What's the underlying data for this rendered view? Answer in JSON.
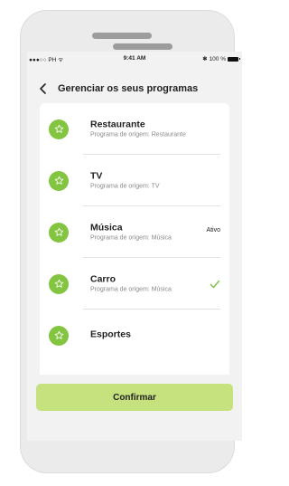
{
  "statusbar": {
    "carrier": "●●●○○ PH ᯤ",
    "time": "9:41 AM",
    "bluetooth": "✱",
    "battery_percent": "100 %"
  },
  "header": {
    "back_icon": "chevron-left-icon",
    "title": "Gerenciar os seus programas"
  },
  "programs": [
    {
      "name": "Restaurante",
      "origin": "Programa de origem: Restaurante",
      "status": "",
      "checked": false
    },
    {
      "name": "TV",
      "origin": "Programa de origem: TV",
      "status": "",
      "checked": false
    },
    {
      "name": "Música",
      "origin": "Programa de origem: Música",
      "status": "Ativo",
      "checked": false
    },
    {
      "name": "Carro",
      "origin": "Programa de origem: Música",
      "status": "",
      "checked": true
    },
    {
      "name": "Esportes",
      "origin": "",
      "status": "",
      "checked": false
    }
  ],
  "confirm_label": "Confirmar",
  "colors": {
    "accent_green": "#83c541",
    "confirm_bg": "#c6e27e",
    "check_green": "#7dc242"
  }
}
